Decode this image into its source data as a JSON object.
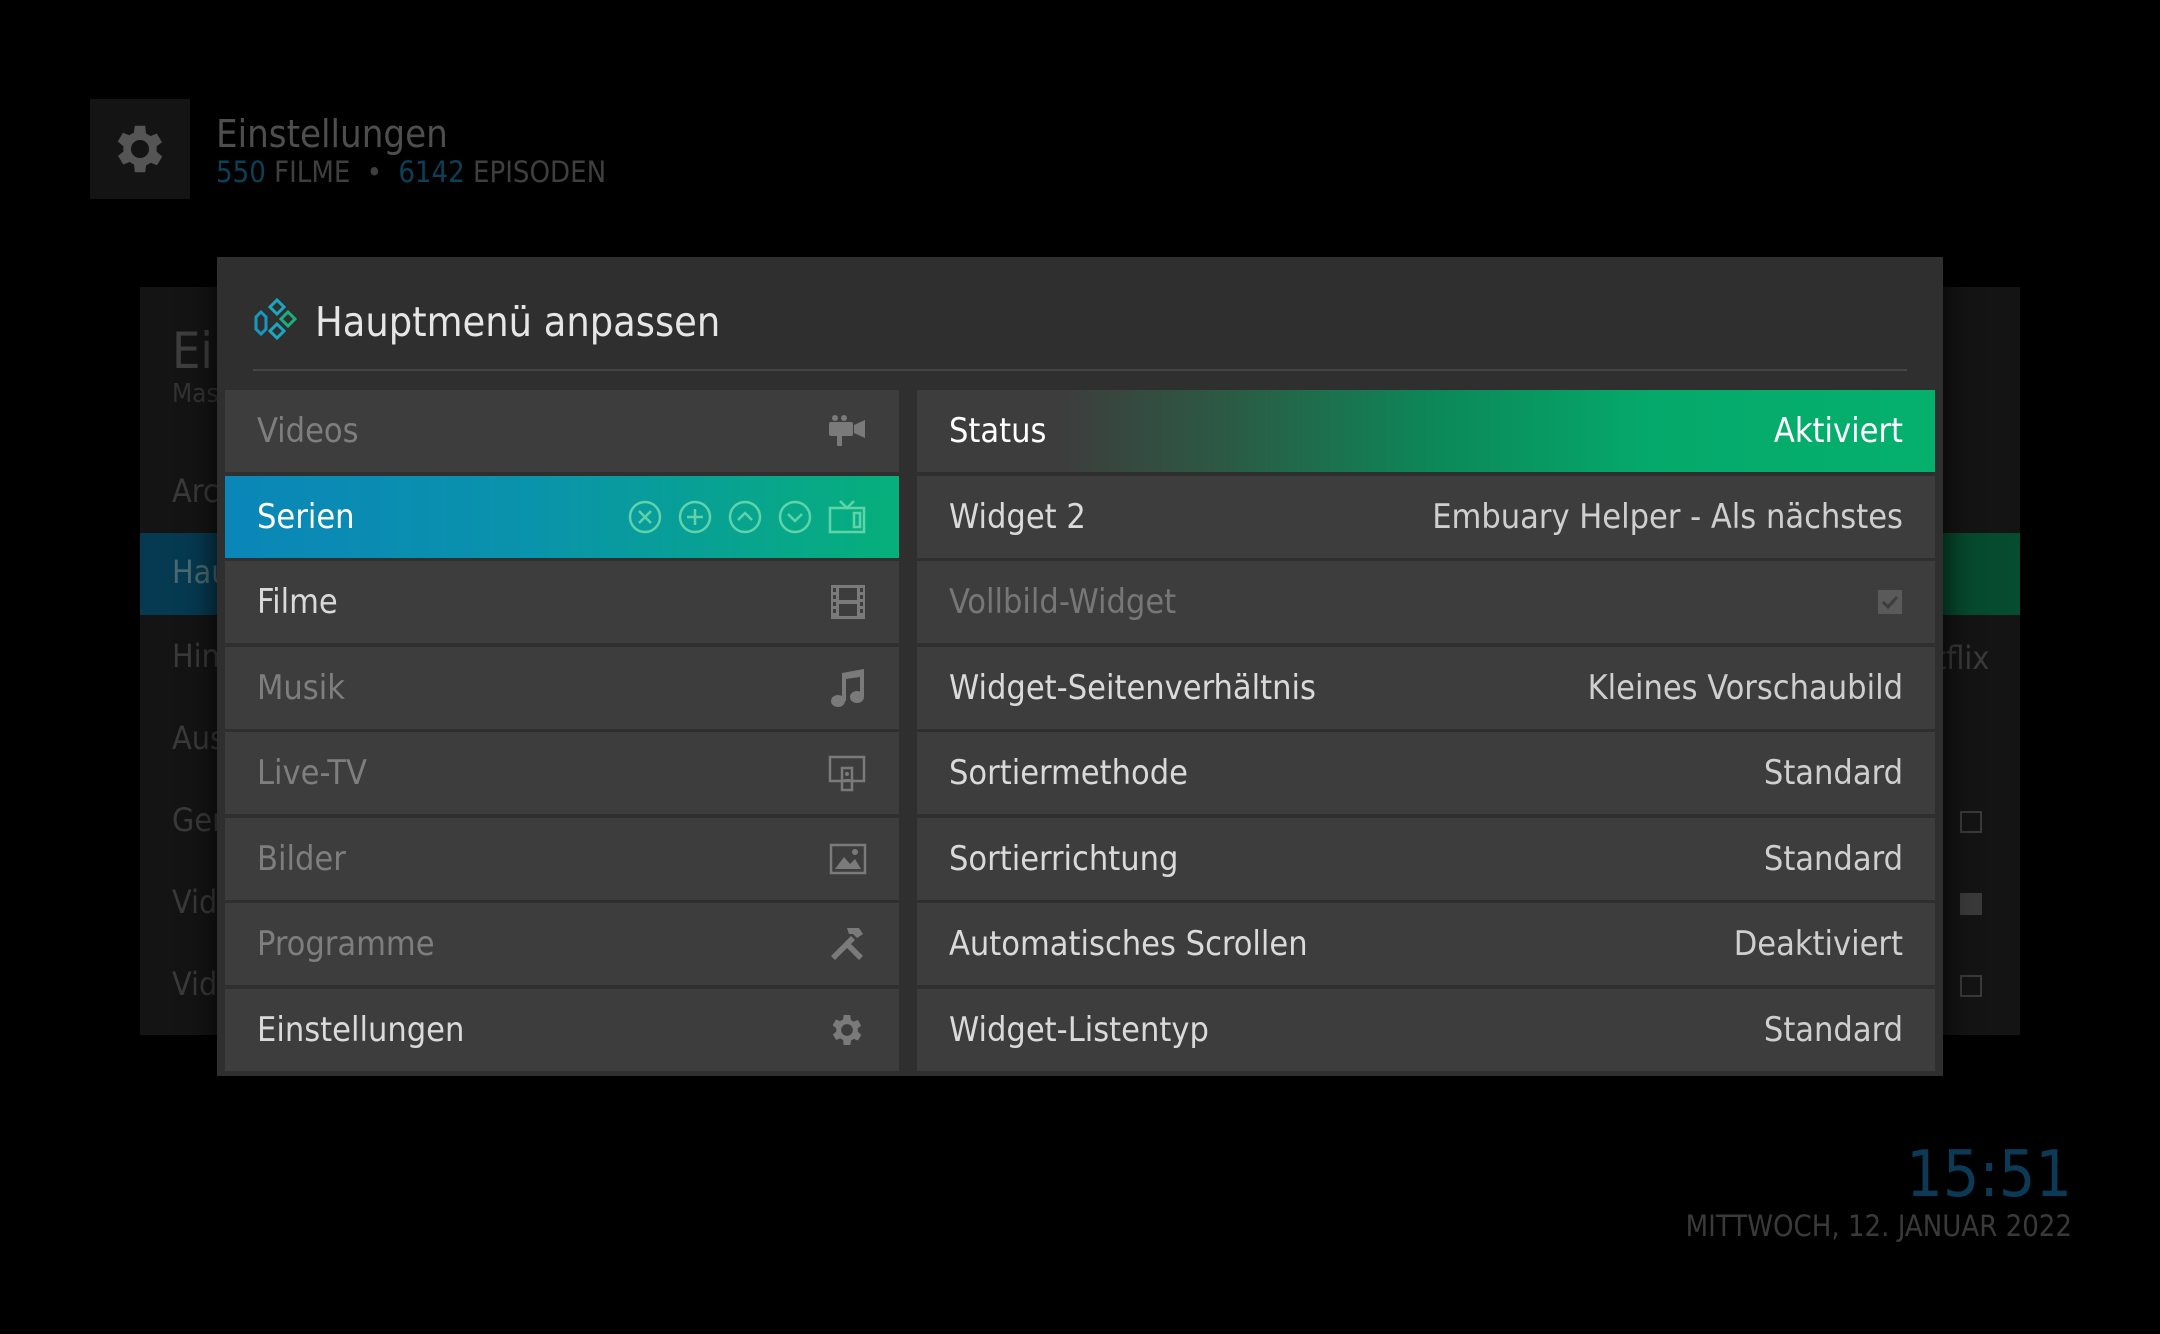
{
  "header": {
    "title": "Einstellungen",
    "movies_count": "550",
    "movies_label": "FILME",
    "separator": "•",
    "episodes_count": "6142",
    "episodes_label": "EPISODEN"
  },
  "background_panel": {
    "title": "Ein",
    "subtitle": "Mas",
    "rows": [
      "Arc",
      "Hau",
      "Hint",
      "Aus",
      "Ger",
      "Vide",
      "Vide"
    ],
    "right_text": "tflix"
  },
  "clock": {
    "time": "15:51",
    "date": "MITTWOCH, 12. JANUAR 2022"
  },
  "dialog": {
    "title": "Hauptmenü anpassen",
    "menu_items": [
      {
        "label": "Videos",
        "icon": "video-camera-icon"
      },
      {
        "label": "Serien",
        "icon": "tv-icon"
      },
      {
        "label": "Filme",
        "icon": "film-strip-icon"
      },
      {
        "label": "Musik",
        "icon": "music-note-icon"
      },
      {
        "label": "Live-TV",
        "icon": "live-tv-icon"
      },
      {
        "label": "Bilder",
        "icon": "picture-icon"
      },
      {
        "label": "Programme",
        "icon": "tools-icon"
      },
      {
        "label": "Einstellungen",
        "icon": "gear-icon"
      }
    ],
    "item_actions": [
      "remove-icon",
      "add-icon",
      "move-up-icon",
      "move-down-icon"
    ],
    "settings": [
      {
        "label": "Status",
        "value": "Aktiviert"
      },
      {
        "label": "Widget 2",
        "value": "Embuary Helper - Als nächstes"
      },
      {
        "label": "Vollbild-Widget",
        "value": ""
      },
      {
        "label": "Widget-Seitenverhältnis",
        "value": "Kleines Vorschaubild"
      },
      {
        "label": "Sortiermethode",
        "value": "Standard"
      },
      {
        "label": "Sortierrichtung",
        "value": "Standard"
      },
      {
        "label": "Automatisches Scrollen",
        "value": "Deaktiviert"
      },
      {
        "label": "Widget-Listentyp",
        "value": "Standard"
      }
    ]
  },
  "colors": {
    "accent_blue": "#0a86b8",
    "accent_green": "#05b06d",
    "dialog_bg": "#2f2f2f",
    "row_bg": "#3d3d3d"
  }
}
